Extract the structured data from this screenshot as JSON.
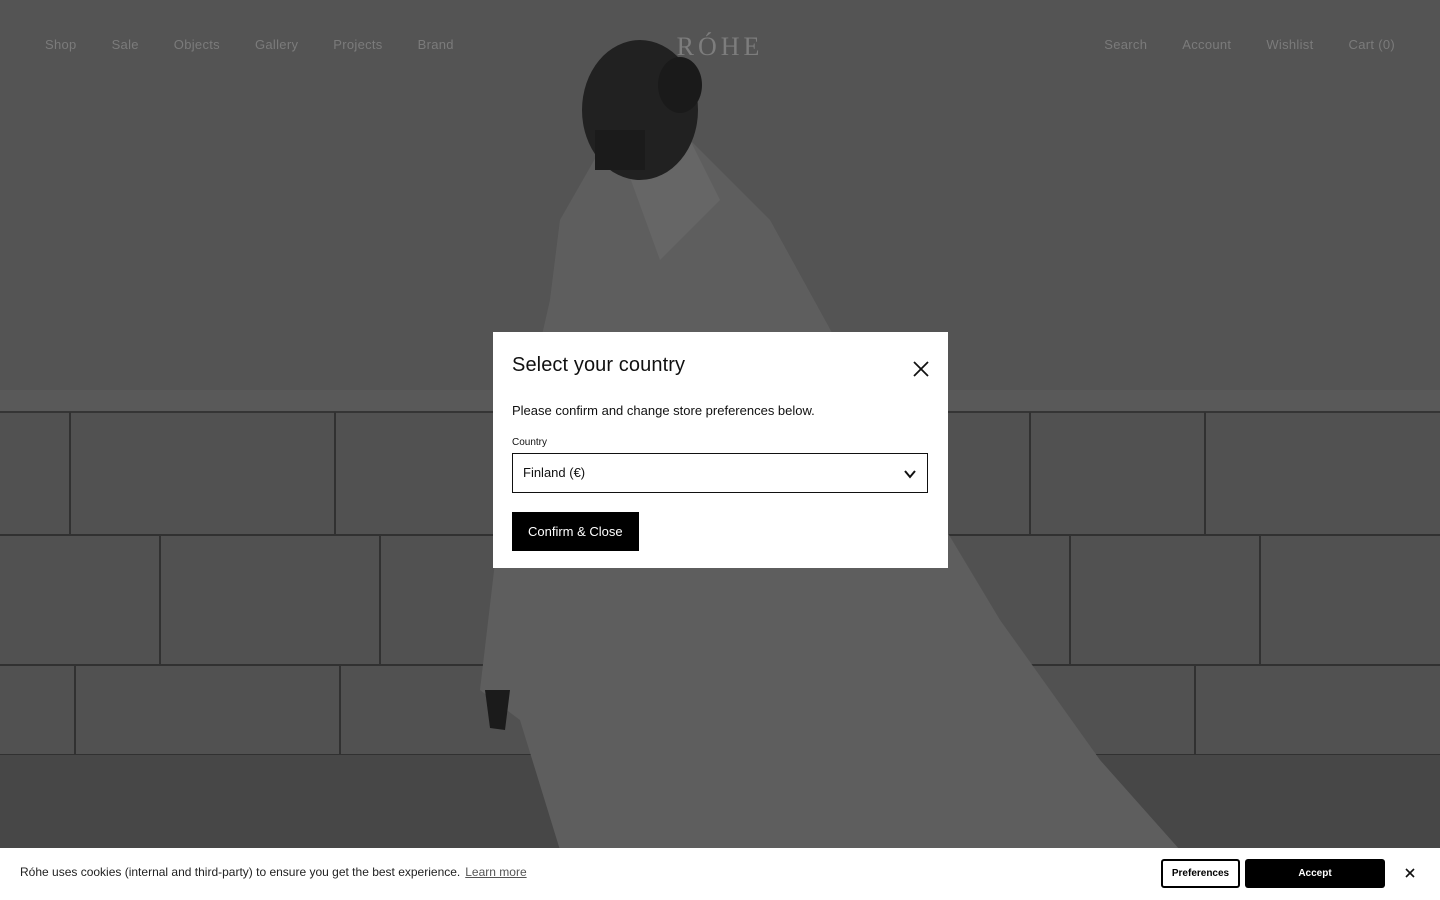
{
  "brand": {
    "logo_text": "RÓHE"
  },
  "nav": {
    "left": [
      "Shop",
      "Sale",
      "Objects",
      "Gallery",
      "Projects",
      "Brand"
    ],
    "right": {
      "search": "Search",
      "account": "Account",
      "wishlist": "Wishlist",
      "cart": "Cart (0)"
    }
  },
  "modal": {
    "title": "Select your country",
    "description": "Please confirm and change store preferences below.",
    "country_label": "Country",
    "country_value": "Finland (€)",
    "confirm_label": "Confirm & Close",
    "close_icon": "close-icon"
  },
  "cookie": {
    "text": "Róhe uses cookies (internal and third-party) to ensure you get the best experience.",
    "learn_more": "Learn more",
    "preferences_label": "Preferences",
    "accept_label": "Accept",
    "close_icon": "close-icon"
  },
  "colors": {
    "modal_bg": "#ffffff",
    "button_bg": "#000000",
    "overlay": "rgba(0,0,0,0.42)"
  }
}
